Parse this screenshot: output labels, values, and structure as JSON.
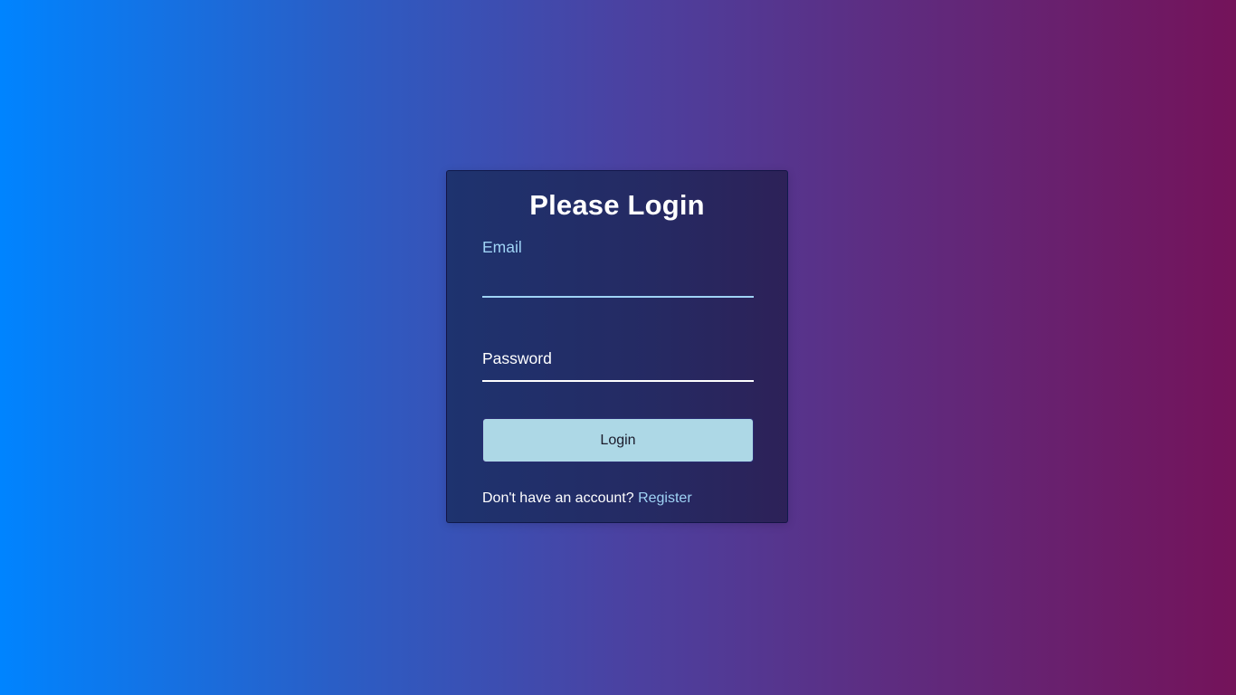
{
  "login_card": {
    "title": "Please Login",
    "email": {
      "label": "Email",
      "value": ""
    },
    "password": {
      "label": "Password",
      "value": ""
    },
    "submit_label": "Login",
    "register_prompt": "Don't have an account?",
    "register_link": "Register"
  },
  "colors": {
    "background_gradient_start": "#0084ff",
    "background_gradient_end": "#74135a",
    "card_background": "#232d66",
    "accent_light_blue": "#9fd3f5",
    "button_background": "#add8e6"
  }
}
